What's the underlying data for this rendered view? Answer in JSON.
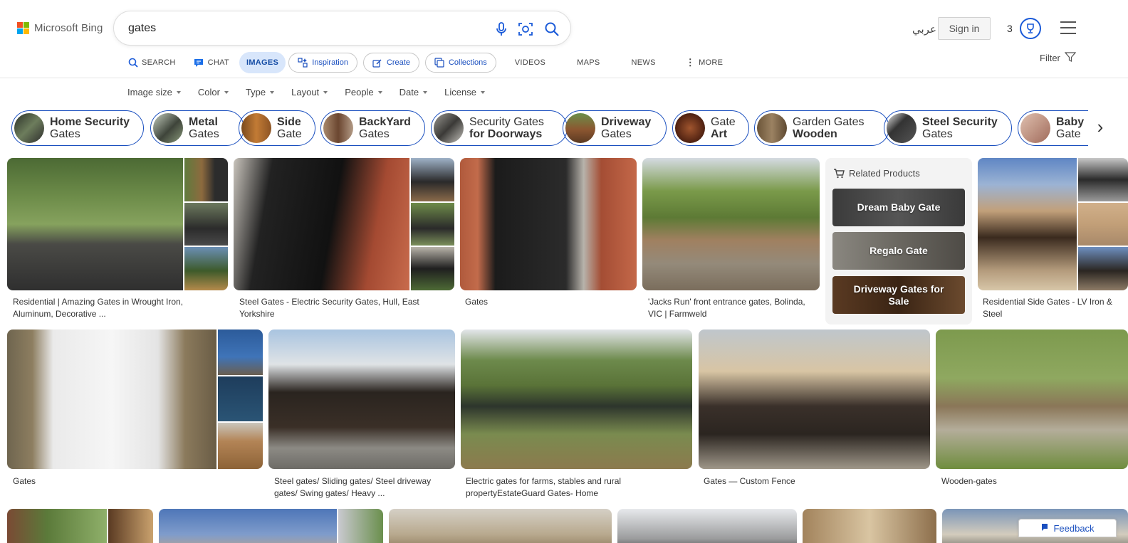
{
  "brand": {
    "name": "Microsoft Bing",
    "logo_colors": [
      "#f25022",
      "#7fba00",
      "#00a4ef",
      "#ffb900"
    ]
  },
  "search": {
    "query": "gates"
  },
  "header": {
    "language_link": "عربي",
    "sign_in": "Sign in",
    "rewards_count": "3",
    "accent": "#1a5ad8"
  },
  "nav": {
    "search": "SEARCH",
    "chat": "CHAT",
    "images": "IMAGES",
    "inspiration": "Inspiration",
    "create": "Create",
    "collections": "Collections",
    "videos": "VIDEOS",
    "maps": "MAPS",
    "news": "NEWS",
    "more": "MORE",
    "filter": "Filter"
  },
  "filters": [
    "Image size",
    "Color",
    "Type",
    "Layout",
    "People",
    "Date",
    "License"
  ],
  "chips": [
    {
      "line1": "Home Security",
      "line2": "Gates",
      "bold_line": 1
    },
    {
      "line1": "Metal",
      "line2": "Gates",
      "bold_line": 1
    },
    {
      "line1": "Side",
      "line2": "Gate",
      "bold_line": 1
    },
    {
      "line1": "BackYard",
      "line2": "Gates",
      "bold_line": 1
    },
    {
      "line1": "Security Gates",
      "line2": "for Doorways",
      "bold_line": 2
    },
    {
      "line1": "Driveway",
      "line2": "Gates",
      "bold_line": 1
    },
    {
      "line1": "Gate",
      "line2": "Art",
      "bold_line": 2
    },
    {
      "line1": "Garden Gates",
      "line2": "Wooden",
      "bold_line": 2
    },
    {
      "line1": "Steel Security",
      "line2": "Gates",
      "bold_line": 1
    },
    {
      "line1": "Baby",
      "line2": "Gate",
      "bold_line": 1
    }
  ],
  "results": {
    "r1": "Residential | Amazing Gates in Wrought Iron, Aluminum, Decorative ...",
    "r2": "Steel Gates - Electric Security Gates, Hull, East Yorkshire",
    "r3": "Gates",
    "r4": "'Jacks Run' front entrance gates, Bolinda, VIC | Farmweld",
    "r5": "Residential Side Gates - LV Iron & Steel",
    "r6": "Gates",
    "r7": "Steel gates/ Sliding gates/ Steel driveway gates/ Swing gates/ Heavy ...",
    "r8": "Electric gates for farms, stables and rural propertyEstateGuard Gates- Home",
    "r9": "Gates — Custom Fence",
    "r10": "Wooden-gates"
  },
  "related_products": {
    "title": "Related Products",
    "items": [
      "Dream Baby Gate",
      "Regalo Gate",
      "Driveway Gates for Sale"
    ]
  },
  "feedback": "Feedback"
}
